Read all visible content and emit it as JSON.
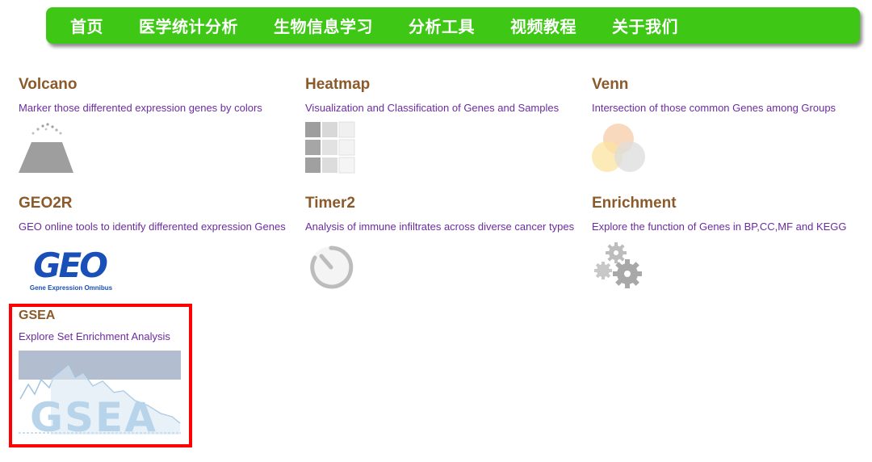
{
  "nav": {
    "items": [
      {
        "label": "首页"
      },
      {
        "label": "医学统计分析"
      },
      {
        "label": "生物信息学习"
      },
      {
        "label": "分析工具"
      },
      {
        "label": "视频教程"
      },
      {
        "label": "关于我们"
      }
    ]
  },
  "tools": [
    {
      "title": "Volcano",
      "desc": "Marker those differented expression genes by colors",
      "icon": "volcano-plot-icon"
    },
    {
      "title": "Heatmap",
      "desc": "Visualization and Classification of Genes and Samples",
      "icon": "heatmap-grid-icon"
    },
    {
      "title": "Venn",
      "desc": "Intersection of those common Genes among Groups",
      "icon": "venn-circles-icon"
    },
    {
      "title": "GEO2R",
      "desc": "GEO online tools to identify differented expression Genes",
      "icon": "geo-logo",
      "logo_text": "GEO",
      "logo_subtitle": "Gene Expression Omnibus"
    },
    {
      "title": "Timer2",
      "desc": "Analysis of immune infiltrates across diverse cancer types",
      "icon": "timer-icon"
    },
    {
      "title": "Enrichment",
      "desc": "Explore the function of Genes in BP,CC,MF and KEGG",
      "icon": "gears-icon"
    },
    {
      "title": "GSEA",
      "desc": "Explore Set Enrichment Analysis",
      "icon": "gsea-logo",
      "logo_text": "GSEA"
    }
  ],
  "colors": {
    "nav_bg": "#3ec815",
    "title": "#8b5a2b",
    "desc": "#6b2ca0",
    "highlight": "#ff0000"
  }
}
